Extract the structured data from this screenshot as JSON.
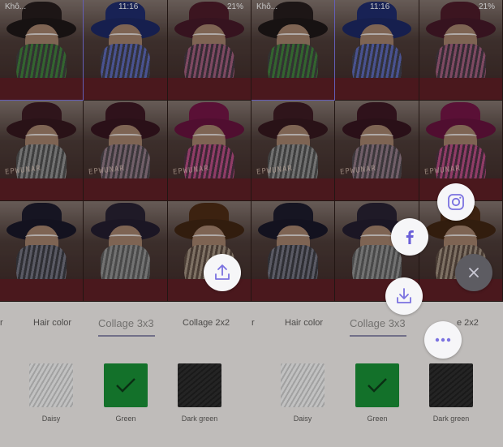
{
  "status": {
    "carrier": "Khô...",
    "time": "11:16",
    "battery": "21%"
  },
  "tabs": {
    "left": {
      "partial_prev": "r",
      "hair_color": "Hair color",
      "collage3": "Collage 3x3",
      "collage2": "Collage 2x2"
    },
    "right": {
      "partial_prev": "r",
      "hair_color": "Hair color",
      "collage3": "Collage 3x3",
      "collage2": "e 2x2"
    }
  },
  "swatches": [
    {
      "label": "Daisy"
    },
    {
      "label": "Green",
      "selected": true
    },
    {
      "label": "Dark green"
    }
  ],
  "tile_text": "EPWUNAR",
  "colors": {
    "accent": "#7a73e0",
    "facebook": "#6a5fd8",
    "share_icon": "#7b72e0"
  },
  "icons": {
    "share": "upload-icon",
    "instagram": "instagram-icon",
    "facebook": "facebook-icon",
    "download": "download-icon",
    "close": "close-icon",
    "more": "more-dots-icon"
  }
}
